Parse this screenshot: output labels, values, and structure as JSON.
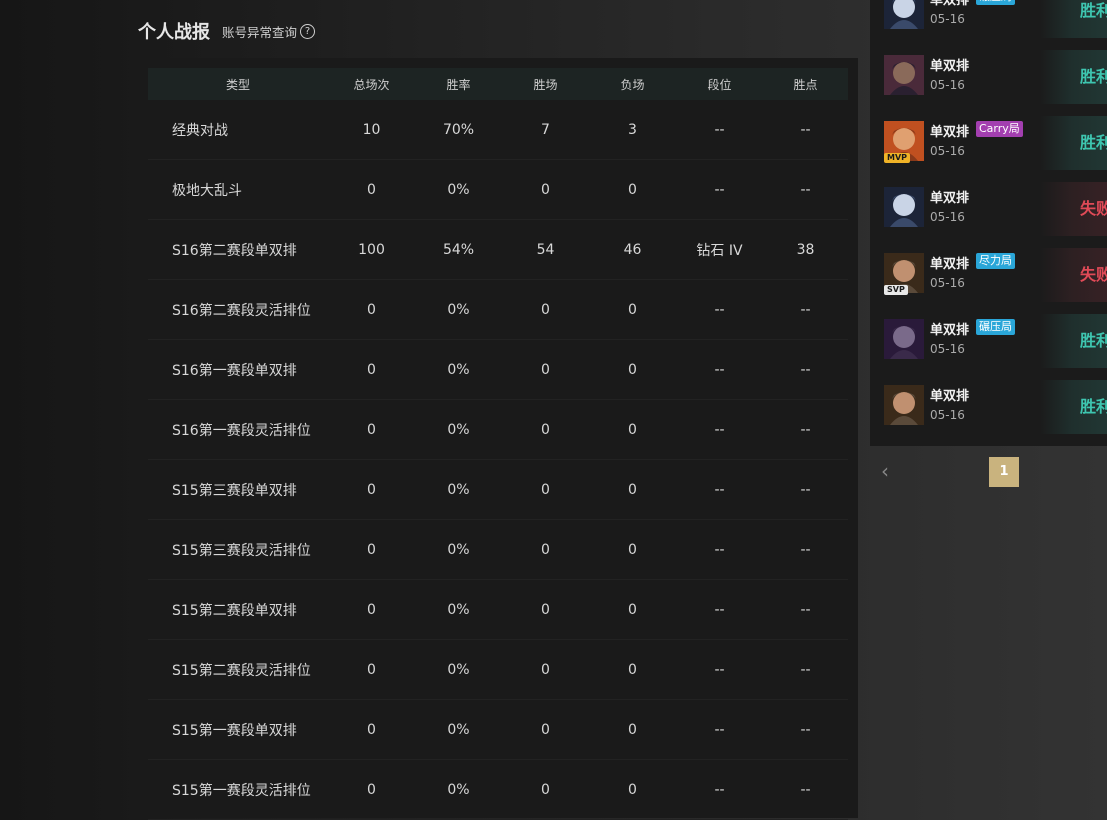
{
  "header": {
    "title": "个人战报",
    "query_link": "账号异常查询",
    "help_icon": "?"
  },
  "table": {
    "columns": [
      "类型",
      "总场次",
      "胜率",
      "胜场",
      "负场",
      "段位",
      "胜点"
    ],
    "rows": [
      [
        "经典对战",
        "10",
        "70%",
        "7",
        "3",
        "--",
        "--"
      ],
      [
        "极地大乱斗",
        "0",
        "0%",
        "0",
        "0",
        "--",
        "--"
      ],
      [
        "S16第二赛段单双排",
        "100",
        "54%",
        "54",
        "46",
        "钻石 IV",
        "38"
      ],
      [
        "S16第二赛段灵活排位",
        "0",
        "0%",
        "0",
        "0",
        "--",
        "--"
      ],
      [
        "S16第一赛段单双排",
        "0",
        "0%",
        "0",
        "0",
        "--",
        "--"
      ],
      [
        "S16第一赛段灵活排位",
        "0",
        "0%",
        "0",
        "0",
        "--",
        "--"
      ],
      [
        "S15第三赛段单双排",
        "0",
        "0%",
        "0",
        "0",
        "--",
        "--"
      ],
      [
        "S15第三赛段灵活排位",
        "0",
        "0%",
        "0",
        "0",
        "--",
        "--"
      ],
      [
        "S15第二赛段单双排",
        "0",
        "0%",
        "0",
        "0",
        "--",
        "--"
      ],
      [
        "S15第二赛段灵活排位",
        "0",
        "0%",
        "0",
        "0",
        "--",
        "--"
      ],
      [
        "S15第一赛段单双排",
        "0",
        "0%",
        "0",
        "0",
        "--",
        "--"
      ],
      [
        "S15第一赛段灵活排位",
        "0",
        "0%",
        "0",
        "0",
        "--",
        "--"
      ]
    ]
  },
  "matches": [
    {
      "mode": "单双排",
      "tag": "碾压局",
      "tag_type": "blue",
      "date": "05-16",
      "result": "胜利",
      "win": true,
      "badge": "",
      "avatar": "hooded-champion"
    },
    {
      "mode": "单双排",
      "tag": "",
      "tag_type": "",
      "date": "05-16",
      "result": "胜利",
      "win": true,
      "badge": "",
      "avatar": "eyepatch-champion"
    },
    {
      "mode": "单双排",
      "tag": "Carry局",
      "tag_type": "carry",
      "date": "05-16",
      "result": "胜利",
      "win": true,
      "badge": "MVP",
      "avatar": "redhair-champion"
    },
    {
      "mode": "单双排",
      "tag": "",
      "tag_type": "",
      "date": "05-16",
      "result": "失败",
      "win": false,
      "badge": "",
      "avatar": "hooded-champion"
    },
    {
      "mode": "单双排",
      "tag": "尽力局",
      "tag_type": "blue",
      "date": "05-16",
      "result": "失败",
      "win": false,
      "badge": "SVP",
      "avatar": "warrior-champion"
    },
    {
      "mode": "单双排",
      "tag": "碾压局",
      "tag_type": "blue",
      "date": "05-16",
      "result": "胜利",
      "win": true,
      "badge": "",
      "avatar": "purple-champion"
    },
    {
      "mode": "单双排",
      "tag": "",
      "tag_type": "",
      "date": "05-16",
      "result": "胜利",
      "win": true,
      "badge": "",
      "avatar": "warrior-champion"
    }
  ],
  "pagination": {
    "prev_icon": "chevron-left-icon",
    "prev_glyph": "‹",
    "current_page": "1"
  },
  "colors": {
    "win": "#3ec6b0",
    "lose": "#e04a57",
    "page_active": "#c9b37e",
    "carry_tag": "#a33fb0",
    "blue_tag": "#2aa6d8",
    "mvp_badge": "#f0b327"
  }
}
